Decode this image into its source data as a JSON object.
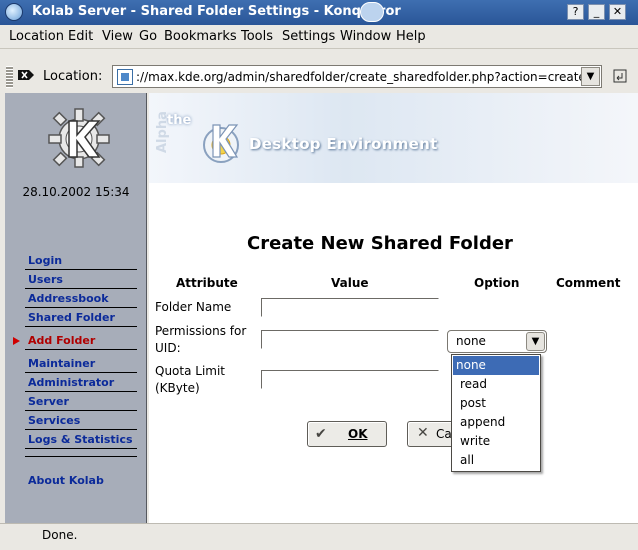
{
  "window": {
    "title": "Kolab Server - Shared Folder Settings - Konqueror",
    "buttons": {
      "help": "?",
      "minimize": "_",
      "maximize": "□",
      "close": "✕"
    }
  },
  "menu": [
    "Location",
    "Edit",
    "View",
    "Go",
    "Bookmarks",
    "Tools",
    "Settings",
    "Window",
    "Help"
  ],
  "location_bar": {
    "label": "Location:",
    "url": "://max.kde.org/admin/sharedfolder/create_sharedfolder.php?action=create"
  },
  "sidebar": {
    "datetime": "28.10.2002 15:34",
    "items": [
      {
        "label": "Login",
        "active": false
      },
      {
        "label": "Users",
        "active": false
      },
      {
        "label": "Addressbook",
        "active": false
      },
      {
        "label": "Shared Folder",
        "active": false
      },
      {
        "label": "Add Folder",
        "active": true
      },
      {
        "label": "Maintainer",
        "active": false
      },
      {
        "label": "Administrator",
        "active": false
      },
      {
        "label": "Server",
        "active": false
      },
      {
        "label": "Services",
        "active": false
      },
      {
        "label": "Logs & Statistics",
        "active": false
      },
      {
        "label": "About Kolab",
        "active": false
      }
    ]
  },
  "banner": {
    "alpha": "Alpha",
    "the": "the",
    "text": "Desktop Environment"
  },
  "form": {
    "title": "Create New Shared Folder",
    "columns": {
      "attribute": "Attribute",
      "value": "Value",
      "option": "Option",
      "comment": "Comment"
    },
    "rows": [
      {
        "label": "Folder Name",
        "value": ""
      },
      {
        "label": "Permissions for UID:",
        "value": ""
      },
      {
        "label": "Quota Limit (KByte)",
        "value": ""
      }
    ],
    "permission_select": {
      "value": "none",
      "options": [
        "none",
        "read",
        "post",
        "append",
        "write",
        "all"
      ],
      "highlighted": "none"
    },
    "ok_label": "OK",
    "cancel_label": "Ca"
  },
  "status": {
    "text": "Done."
  }
}
